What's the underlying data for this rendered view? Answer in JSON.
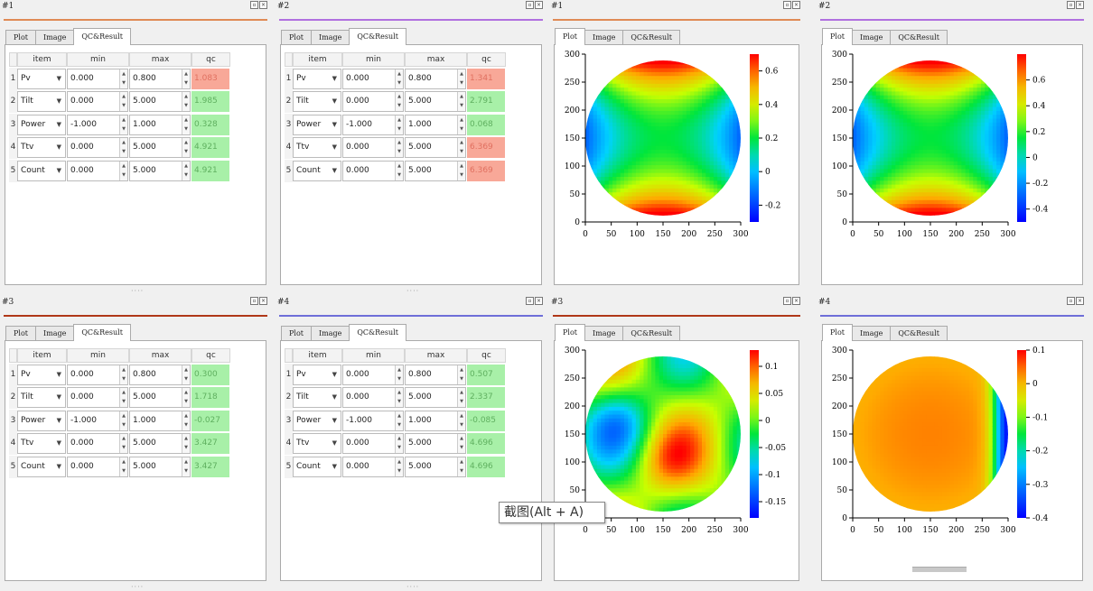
{
  "tab_labels": [
    "Plot",
    "Image",
    "QC&Result"
  ],
  "columns": [
    "item",
    "min",
    "max",
    "qc"
  ],
  "colors": {
    "pass": "#a8f0a8",
    "fail": "#f8a898"
  },
  "tooltip": "截图(Alt + A)",
  "pane_buttons": [
    "restore-icon",
    "close-icon"
  ],
  "table_panes": [
    {
      "title": "#1",
      "accent": "#e08a55",
      "x": 0,
      "y": 0,
      "rows": [
        {
          "n": "1",
          "item": "Pv",
          "min": "0.000",
          "max": "0.800",
          "qc": "1.083",
          "status": "fail"
        },
        {
          "n": "2",
          "item": "Tilt",
          "min": "0.000",
          "max": "5.000",
          "qc": "1.985",
          "status": "pass"
        },
        {
          "n": "3",
          "item": "Power",
          "min": "-1.000",
          "max": "1.000",
          "qc": "0.328",
          "status": "pass"
        },
        {
          "n": "4",
          "item": "Ttv",
          "min": "0.000",
          "max": "5.000",
          "qc": "4.921",
          "status": "pass"
        },
        {
          "n": "5",
          "item": "Count",
          "min": "0.000",
          "max": "5.000",
          "qc": "4.921",
          "status": "pass"
        }
      ]
    },
    {
      "title": "#2",
      "accent": "#b070e0",
      "x": 305,
      "y": 0,
      "rows": [
        {
          "n": "1",
          "item": "Pv",
          "min": "0.000",
          "max": "0.800",
          "qc": "1.341",
          "status": "fail"
        },
        {
          "n": "2",
          "item": "Tilt",
          "min": "0.000",
          "max": "5.000",
          "qc": "2.791",
          "status": "pass"
        },
        {
          "n": "3",
          "item": "Power",
          "min": "-1.000",
          "max": "1.000",
          "qc": "0.068",
          "status": "pass"
        },
        {
          "n": "4",
          "item": "Ttv",
          "min": "0.000",
          "max": "5.000",
          "qc": "6.369",
          "status": "fail"
        },
        {
          "n": "5",
          "item": "Count",
          "min": "0.000",
          "max": "5.000",
          "qc": "6.369",
          "status": "fail"
        }
      ]
    },
    {
      "title": "#3",
      "accent": "#b03818",
      "x": 0,
      "y": 328,
      "rows": [
        {
          "n": "1",
          "item": "Pv",
          "min": "0.000",
          "max": "0.800",
          "qc": "0.300",
          "status": "pass"
        },
        {
          "n": "2",
          "item": "Tilt",
          "min": "0.000",
          "max": "5.000",
          "qc": "1.718",
          "status": "pass"
        },
        {
          "n": "3",
          "item": "Power",
          "min": "-1.000",
          "max": "1.000",
          "qc": "-0.027",
          "status": "pass"
        },
        {
          "n": "4",
          "item": "Ttv",
          "min": "0.000",
          "max": "5.000",
          "qc": "3.427",
          "status": "pass"
        },
        {
          "n": "5",
          "item": "Count",
          "min": "0.000",
          "max": "5.000",
          "qc": "3.427",
          "status": "pass"
        }
      ]
    },
    {
      "title": "#4",
      "accent": "#6e6ed8",
      "x": 305,
      "y": 328,
      "rows": [
        {
          "n": "1",
          "item": "Pv",
          "min": "0.000",
          "max": "0.800",
          "qc": "0.507",
          "status": "pass"
        },
        {
          "n": "2",
          "item": "Tilt",
          "min": "0.000",
          "max": "5.000",
          "qc": "2.337",
          "status": "pass"
        },
        {
          "n": "3",
          "item": "Power",
          "min": "-1.000",
          "max": "1.000",
          "qc": "-0.085",
          "status": "pass"
        },
        {
          "n": "4",
          "item": "Ttv",
          "min": "0.000",
          "max": "5.000",
          "qc": "4.696",
          "status": "pass"
        },
        {
          "n": "5",
          "item": "Count",
          "min": "0.000",
          "max": "5.000",
          "qc": "4.696",
          "status": "pass"
        }
      ]
    }
  ],
  "chart_data": [
    {
      "type": "heatmap",
      "title": "#1",
      "accent": "#e08a55",
      "x_ticks": [
        0,
        50,
        100,
        150,
        200,
        250,
        300
      ],
      "y_ticks": [
        0,
        50,
        100,
        150,
        200,
        250,
        300
      ],
      "xlim": [
        0,
        300
      ],
      "ylim": [
        0,
        300
      ],
      "legend": "right colorbar",
      "colorbar_ticks": [
        "0.6",
        "0.4",
        "0.2",
        "0",
        "-0.2"
      ],
      "colorbar_range": [
        -0.3,
        0.7
      ],
      "pattern": "saddle",
      "amplitude": [
        0.7,
        -0.3
      ]
    },
    {
      "type": "heatmap",
      "title": "#2",
      "accent": "#b070e0",
      "x_ticks": [
        0,
        50,
        100,
        150,
        200,
        250,
        300
      ],
      "y_ticks": [
        0,
        50,
        100,
        150,
        200,
        250,
        300
      ],
      "xlim": [
        0,
        300
      ],
      "ylim": [
        0,
        300
      ],
      "legend": "right colorbar",
      "colorbar_ticks": [
        "0.6",
        "0.4",
        "0.2",
        "0",
        "-0.2",
        "-0.4"
      ],
      "colorbar_range": [
        -0.5,
        0.8
      ],
      "pattern": "saddle",
      "amplitude": [
        0.8,
        -0.5
      ]
    },
    {
      "type": "heatmap",
      "title": "#3",
      "accent": "#b03818",
      "x_ticks": [
        0,
        50,
        100,
        150,
        200,
        250,
        300
      ],
      "y_ticks": [
        0,
        50,
        100,
        150,
        200,
        250,
        300
      ],
      "xlim": [
        0,
        300
      ],
      "ylim": [
        0,
        300
      ],
      "legend": "right colorbar",
      "colorbar_ticks": [
        "0.1",
        "0.05",
        "0",
        "-0.05",
        "-0.1",
        "-0.15"
      ],
      "colorbar_range": [
        -0.18,
        0.13
      ],
      "pattern": "blobs",
      "amplitude": [
        0.13,
        -0.18
      ]
    },
    {
      "type": "heatmap",
      "title": "#4",
      "accent": "#6e6ed8",
      "x_ticks": [
        0,
        50,
        100,
        150,
        200,
        250,
        300
      ],
      "y_ticks": [
        0,
        50,
        100,
        150,
        200,
        250,
        300
      ],
      "xlim": [
        0,
        300
      ],
      "ylim": [
        0,
        300
      ],
      "legend": "right colorbar",
      "colorbar_ticks": [
        "0.1",
        "0",
        "-0.1",
        "-0.2",
        "-0.3",
        "-0.4"
      ],
      "colorbar_range": [
        -0.4,
        0.1
      ],
      "pattern": "edge",
      "amplitude": [
        0.1,
        -0.4
      ]
    }
  ]
}
